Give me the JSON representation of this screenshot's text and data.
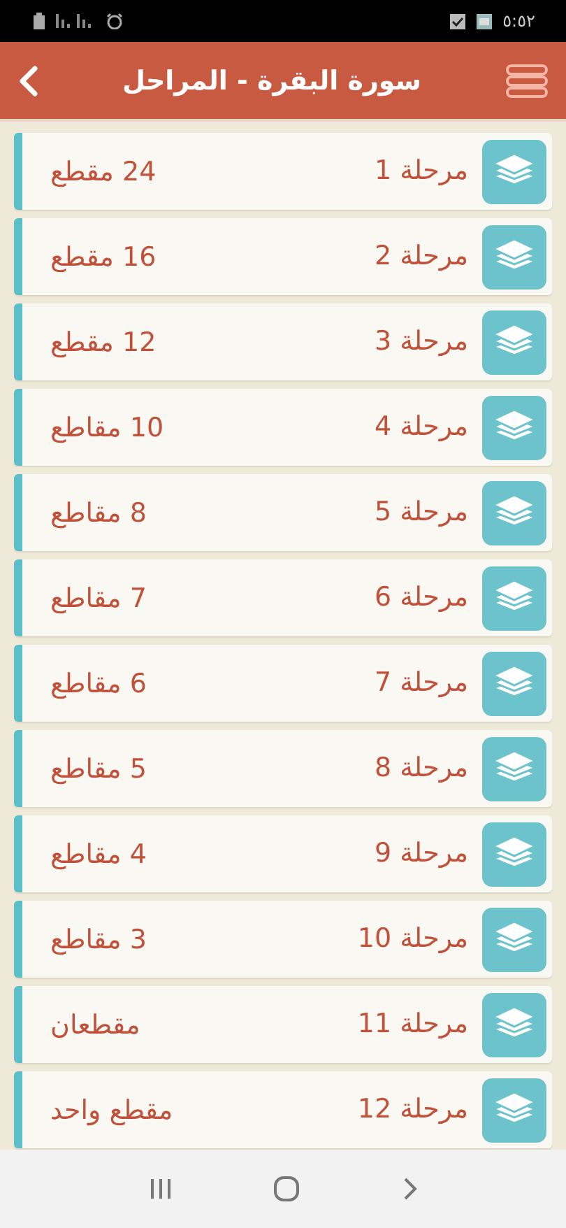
{
  "status_bar": {
    "time": "٥:٥٢"
  },
  "header": {
    "title": "سورة البقرة - المراحل"
  },
  "stages": [
    {
      "label": "مرحلة 1",
      "count": "24 مقطع"
    },
    {
      "label": "مرحلة 2",
      "count": "16 مقطع"
    },
    {
      "label": "مرحلة 3",
      "count": "12 مقطع"
    },
    {
      "label": "مرحلة 4",
      "count": "10 مقاطع"
    },
    {
      "label": "مرحلة 5",
      "count": "8 مقاطع"
    },
    {
      "label": "مرحلة 6",
      "count": "7 مقاطع"
    },
    {
      "label": "مرحلة 7",
      "count": "6 مقاطع"
    },
    {
      "label": "مرحلة 8",
      "count": "5 مقاطع"
    },
    {
      "label": "مرحلة 9",
      "count": "4 مقاطع"
    },
    {
      "label": "مرحلة 10",
      "count": "3 مقاطع"
    },
    {
      "label": "مرحلة 11",
      "count": "مقطعان"
    },
    {
      "label": "مرحلة 12",
      "count": "مقطع واحد"
    }
  ]
}
